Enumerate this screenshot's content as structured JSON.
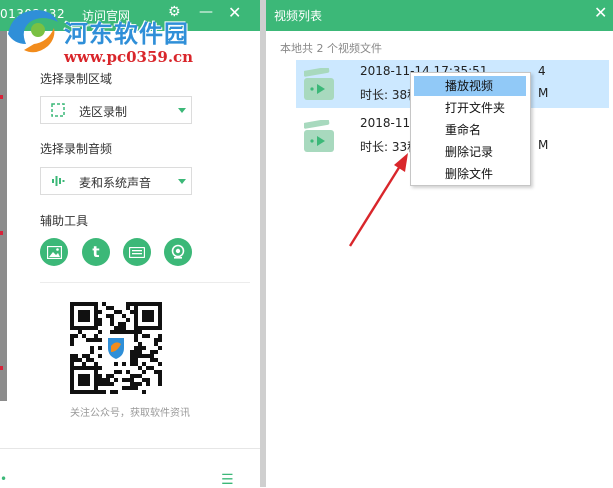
{
  "left_panel": {
    "header": {
      "id_text": "01302432",
      "site_link": "访问官网"
    },
    "area_label": "选择录制区域",
    "area_select": "选区录制",
    "audio_label": "选择录制音频",
    "audio_select": "麦和系统声音",
    "tools_label": "辅助工具",
    "tools": [
      "image-icon",
      "text-t-icon",
      "keyboard-icon",
      "camera-icon"
    ],
    "follow_text": "关注公众号，获取软件资讯"
  },
  "right_panel": {
    "title": "视频列表",
    "summary": "本地共 2 个视频文件",
    "videos": [
      {
        "date": "2018-11-14 17:35:51",
        "tail_top": "4",
        "duration": "时长: 38秒",
        "tail": "M"
      },
      {
        "date": "2018-11-",
        "duration": "时长: 33秒",
        "tail": "M"
      }
    ]
  },
  "context_menu": {
    "items": [
      "播放视频",
      "打开文件夹",
      "重命名",
      "删除记录",
      "删除文件"
    ]
  },
  "watermark": {
    "title": "河东软件园",
    "url": "www.pc0359.cn"
  },
  "colors": {
    "accent": "#3cb878",
    "selection": "#cce8ff",
    "menu_highlight": "#91c9f7",
    "arrow": "#d9262b"
  }
}
